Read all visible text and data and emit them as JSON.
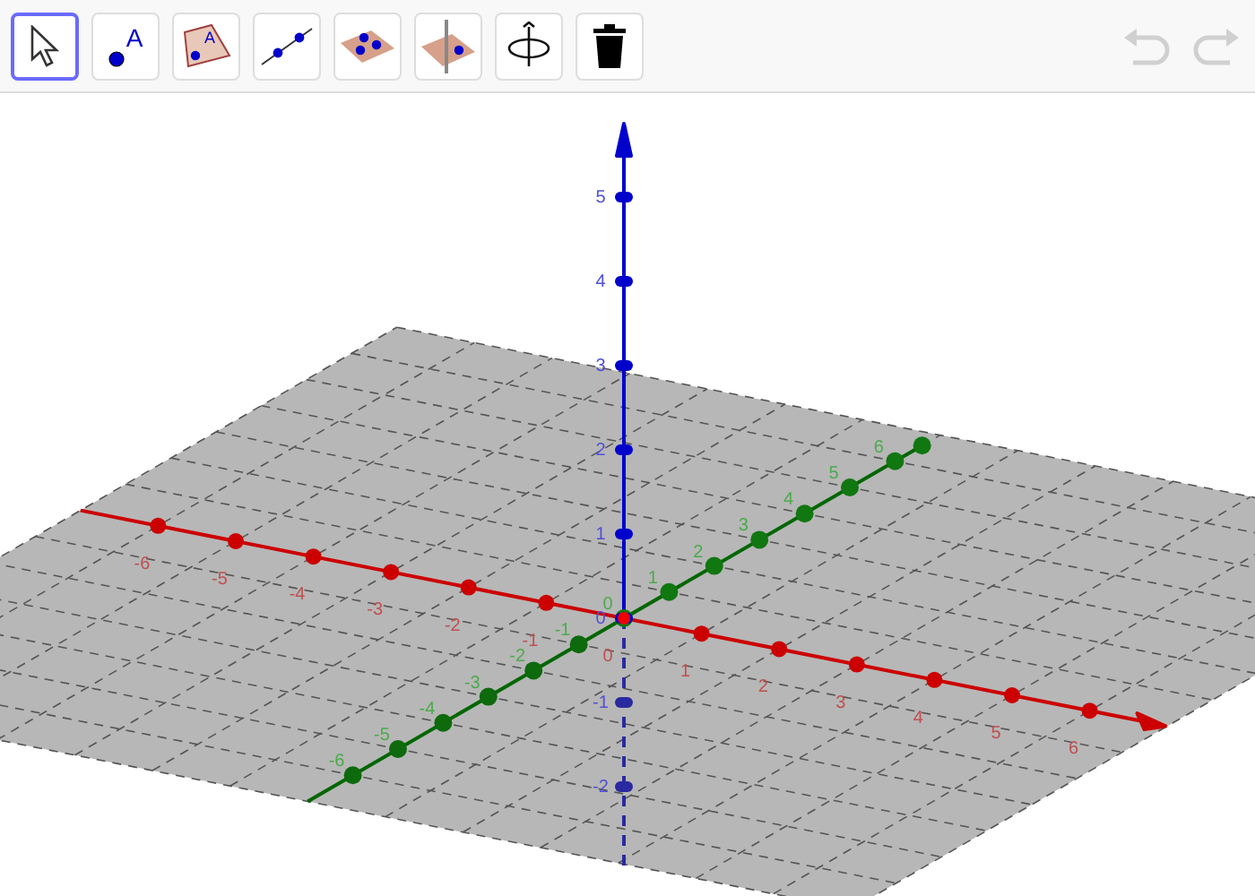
{
  "toolbar": {
    "tools": [
      {
        "kind": "move",
        "selected": true
      },
      {
        "kind": "point",
        "selected": false,
        "icon_letter": "A"
      },
      {
        "kind": "polygon",
        "selected": false,
        "icon_letter": "A"
      },
      {
        "kind": "line",
        "selected": false
      },
      {
        "kind": "plane-points",
        "selected": false
      },
      {
        "kind": "perpendicular-plane",
        "selected": false
      },
      {
        "kind": "rotate",
        "selected": false
      },
      {
        "kind": "delete",
        "selected": false
      }
    ],
    "history": [
      {
        "kind": "undo",
        "disabled": true
      },
      {
        "kind": "redo",
        "disabled": true
      }
    ]
  },
  "graphics_3d": {
    "x_axis": {
      "labels": [
        "-6",
        "-5",
        "-4",
        "-3",
        "-2",
        "-1",
        "0",
        "1",
        "2",
        "3",
        "4",
        "5",
        "6"
      ]
    },
    "y_axis": {
      "labels": [
        "-6",
        "-5",
        "-4",
        "-3",
        "-2",
        "-1",
        "0",
        "1",
        "2",
        "3",
        "4",
        "5",
        "6"
      ]
    },
    "z_axis": {
      "labels": [
        "5",
        "4",
        "3",
        "2",
        "1",
        "0",
        "-1",
        "-2"
      ]
    }
  }
}
